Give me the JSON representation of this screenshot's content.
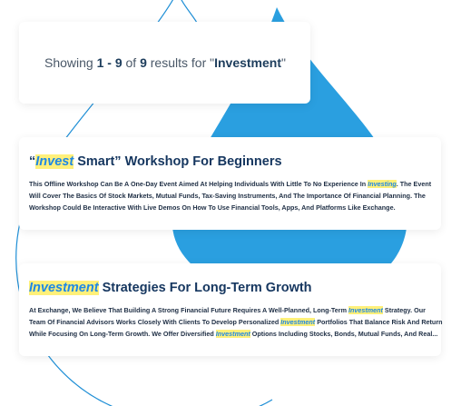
{
  "summary": {
    "prefix": "Showing",
    "range": "1 - 9",
    "of": "of",
    "total": "9",
    "mid": "results for \"",
    "query": "Investment",
    "suffix": "\""
  },
  "results": [
    {
      "title_open_quote": "“",
      "title_highlight": "Invest",
      "title_rest": " Smart” Workshop For Beginners",
      "desc_1": "This Offline Workshop Can Be A One-Day Event Aimed At Helping Individuals With Little To No Experience In ",
      "desc_hl_1": "Investing",
      "desc_2": ". The Event Will Cover The Basics Of Stock Markets, Mutual Funds, Tax-Saving Instruments, And The Importance Of Financial Planning. The Workshop Could Be Interactive With Live Demos On How To Use Financial Tools, Apps, And Platforms Like Exchange."
    },
    {
      "title_highlight": "Investment",
      "title_rest": " Strategies For Long-Term Growth",
      "desc_1": "At Exchange, We Believe That Building A Strong Financial Future Requires A Well-Planned, Long-Term ",
      "desc_hl_1": "Investment",
      "desc_2": " Strategy. Our Team Of Financial Advisors Works Closely With Clients To Develop Personalized ",
      "desc_hl_2": "Investment",
      "desc_3": " Portfolios That Balance Risk And Return While Focusing On Long-Term Growth. We Offer Diversified ",
      "desc_hl_3": "Investment",
      "desc_4": " Options Including Stocks, Bonds, Mutual Funds, And Real..."
    }
  ],
  "colors": {
    "accent": "#2a9fe0",
    "outline": "#1f8fd6",
    "highlight": "#fff07a",
    "title": "#15365f"
  }
}
